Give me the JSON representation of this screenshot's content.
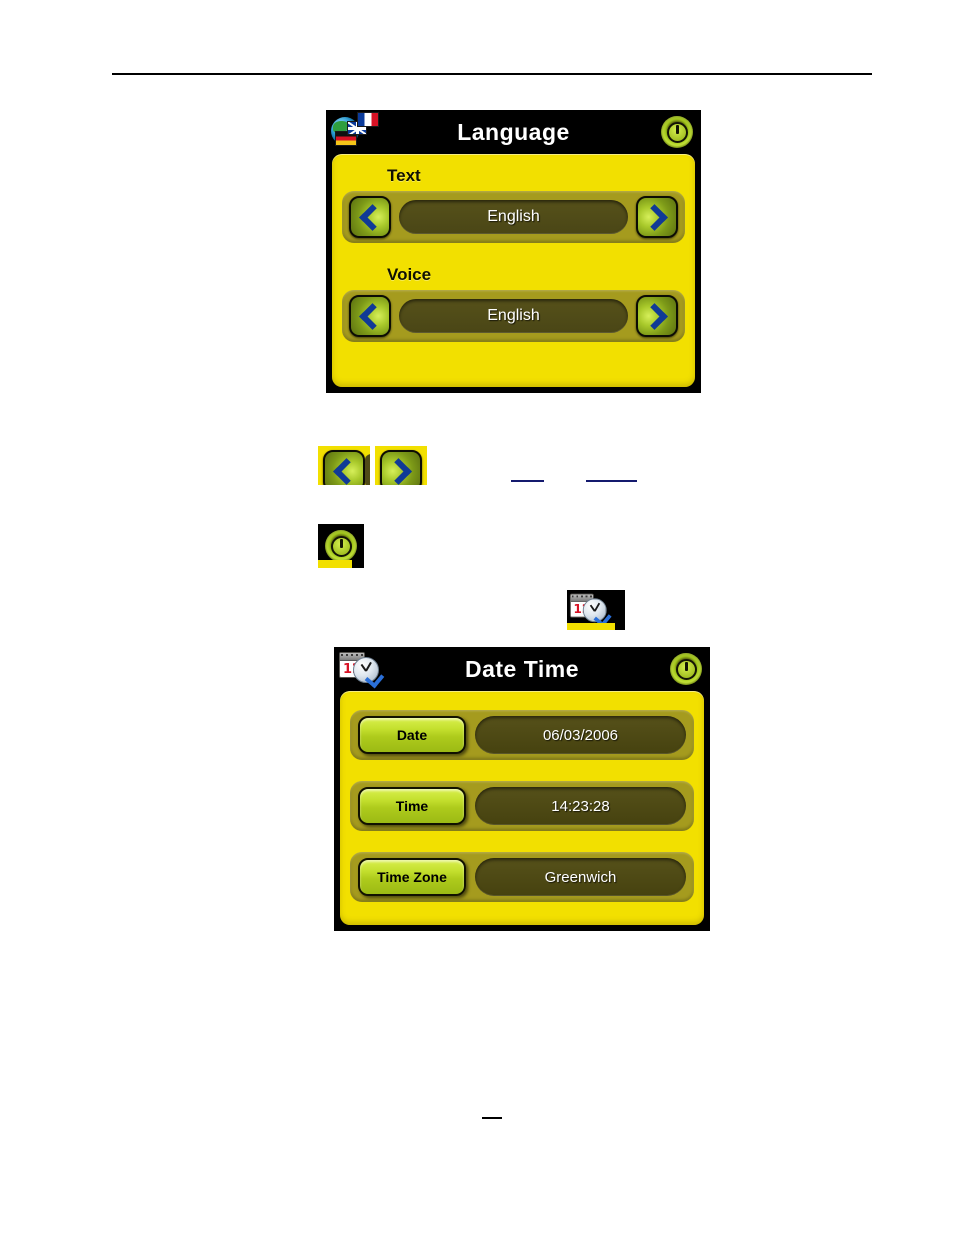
{
  "page": {
    "rule": "horizontal-rule",
    "inline_links": [
      "",
      ""
    ],
    "bottom_mark": ""
  },
  "language_screen": {
    "title": "Language",
    "icon": "language-globe-flags-icon",
    "power_icon": "power-button-icon",
    "groups": [
      {
        "label": "Text",
        "value": "English",
        "prev_icon": "chevron-left-icon",
        "next_icon": "chevron-right-icon"
      },
      {
        "label": "Voice",
        "value": "English",
        "prev_icon": "chevron-left-icon",
        "next_icon": "chevron-right-icon"
      }
    ]
  },
  "standalone_icons": {
    "left_arrow": "chevron-left-icon",
    "right_arrow": "chevron-right-icon",
    "power": "power-button-icon",
    "date_time": "date-time-calendar-clock-icon"
  },
  "date_time_screen": {
    "title": "Date Time",
    "icon": "date-time-calendar-clock-icon",
    "power_icon": "power-button-icon",
    "calendar_day": "12",
    "rows": [
      {
        "label": "Date",
        "value": "06/03/2006"
      },
      {
        "label": "Time",
        "value": "14:23:28"
      },
      {
        "label": "Time Zone",
        "value": "Greenwich"
      }
    ]
  },
  "colors": {
    "screen_yellow": "#f2e000",
    "row_olive": "#a59b1e",
    "field_dark": "#4a4616",
    "button_green": "#c4e02e",
    "chevron_blue": "#103a96",
    "frame_black": "#000000",
    "link_blue": "#141a6e"
  }
}
